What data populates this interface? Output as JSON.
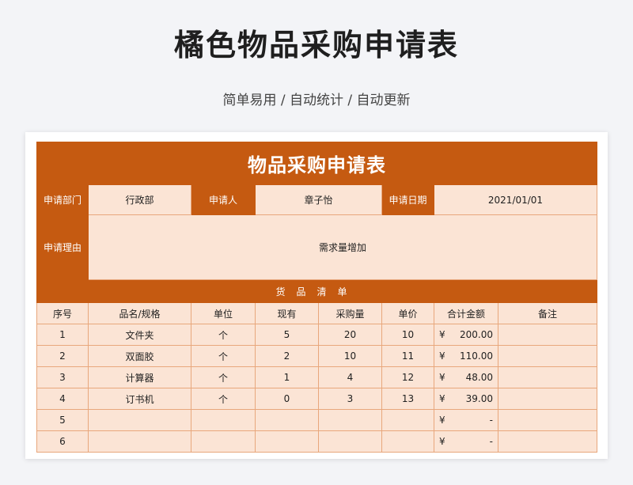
{
  "page": {
    "title": "橘色物品采购申请表",
    "subtitle": "简单易用 / 自动统计 / 自动更新"
  },
  "form": {
    "title": "物品采购申请表",
    "department_label": "申请部门",
    "department": "行政部",
    "applicant_label": "申请人",
    "applicant": "章子怡",
    "date_label": "申请日期",
    "date": "2021/01/01",
    "reason_label": "申请理由",
    "reason": "需求量增加",
    "section_title": "货品清单",
    "columns": [
      "序号",
      "品名/规格",
      "单位",
      "现有",
      "采购量",
      "单价",
      "合计金额",
      "备注"
    ],
    "currency": "¥",
    "rows": [
      {
        "no": "1",
        "name": "文件夹",
        "unit": "个",
        "stock": "5",
        "qty": "20",
        "price": "10",
        "total": "200.00",
        "note": ""
      },
      {
        "no": "2",
        "name": "双面胶",
        "unit": "个",
        "stock": "2",
        "qty": "10",
        "price": "11",
        "total": "110.00",
        "note": ""
      },
      {
        "no": "3",
        "name": "计算器",
        "unit": "个",
        "stock": "1",
        "qty": "4",
        "price": "12",
        "total": "48.00",
        "note": ""
      },
      {
        "no": "4",
        "name": "订书机",
        "unit": "个",
        "stock": "0",
        "qty": "3",
        "price": "13",
        "total": "39.00",
        "note": ""
      },
      {
        "no": "5",
        "name": "",
        "unit": "",
        "stock": "",
        "qty": "",
        "price": "",
        "total": "-",
        "note": ""
      },
      {
        "no": "6",
        "name": "",
        "unit": "",
        "stock": "",
        "qty": "",
        "price": "",
        "total": "-",
        "note": ""
      }
    ]
  },
  "colors": {
    "accent": "#c55a11",
    "cell_fill": "#fbe4d5",
    "background": "#f3f4f7"
  }
}
